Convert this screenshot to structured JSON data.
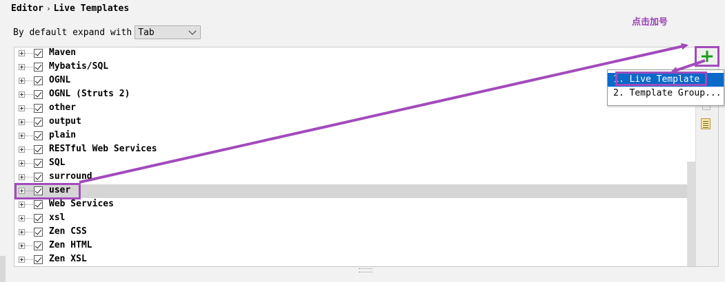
{
  "breadcrumb": {
    "section": "Editor",
    "separator": "›",
    "page": "Live Templates"
  },
  "expand": {
    "label": "By default expand with",
    "value": "Tab"
  },
  "tree": {
    "items": [
      {
        "label": "Maven",
        "checked": true
      },
      {
        "label": "Mybatis/SQL",
        "checked": true
      },
      {
        "label": "OGNL",
        "checked": true
      },
      {
        "label": "OGNL (Struts 2)",
        "checked": true
      },
      {
        "label": "other",
        "checked": true
      },
      {
        "label": "output",
        "checked": true
      },
      {
        "label": "plain",
        "checked": true
      },
      {
        "label": "RESTful Web Services",
        "checked": true
      },
      {
        "label": "SQL",
        "checked": true
      },
      {
        "label": "surround",
        "checked": true
      },
      {
        "label": "user",
        "checked": true,
        "selected": true
      },
      {
        "label": "Web Services",
        "checked": true
      },
      {
        "label": "xsl",
        "checked": true
      },
      {
        "label": "Zen CSS",
        "checked": true
      },
      {
        "label": "Zen HTML",
        "checked": true
      },
      {
        "label": "Zen XSL",
        "checked": true
      }
    ]
  },
  "toolbar": {
    "add_label": "+",
    "icons": [
      "add-icon",
      "copy-icon",
      "template-doc-icon"
    ]
  },
  "popup": {
    "items": [
      "1. Live Template",
      "2. Template Group..."
    ]
  },
  "annotation": {
    "text": "点击加号",
    "color": "#9b3fb5"
  },
  "colors": {
    "add": "#16a016",
    "popup_active": "#0a69c9",
    "selected_row": "#d5d5d5"
  }
}
